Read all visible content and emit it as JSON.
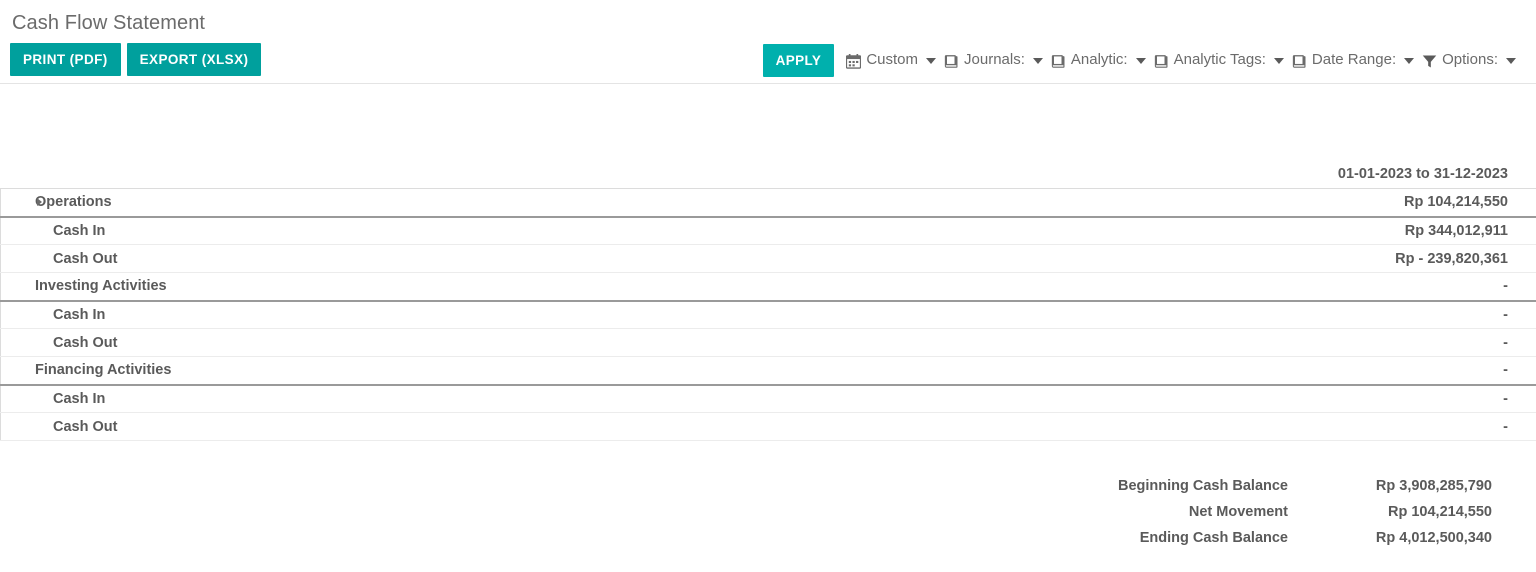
{
  "page": {
    "title": "Cash Flow Statement"
  },
  "toolbar": {
    "print_label": "PRINT (PDF)",
    "export_label": "EXPORT (XLSX)",
    "apply_label": "APPLY",
    "filters": [
      {
        "icon": "calendar-icon",
        "label": "Custom"
      },
      {
        "icon": "book-icon",
        "label": "Journals:"
      },
      {
        "icon": "book-icon",
        "label": "Analytic:"
      },
      {
        "icon": "book-icon",
        "label": "Analytic Tags:"
      },
      {
        "icon": "book-icon",
        "label": "Date Range:"
      },
      {
        "icon": "filter-icon",
        "label": "Options:"
      }
    ]
  },
  "report": {
    "column_header": "01-01-2023 to 31-12-2023",
    "rows": [
      {
        "label": "Operations",
        "value": "Rp  104,214,550",
        "level": 0,
        "expandable": true
      },
      {
        "label": "Cash In",
        "value": "Rp  344,012,911",
        "level": 1,
        "expandable": false
      },
      {
        "label": "Cash Out",
        "value": "Rp - 239,820,361",
        "level": 1,
        "expandable": false
      },
      {
        "label": "Investing Activities",
        "value": "-",
        "level": 0,
        "expandable": false
      },
      {
        "label": "Cash In",
        "value": "-",
        "level": 1,
        "expandable": false
      },
      {
        "label": "Cash Out",
        "value": "-",
        "level": 1,
        "expandable": false
      },
      {
        "label": "Financing Activities",
        "value": "-",
        "level": 0,
        "expandable": false
      },
      {
        "label": "Cash In",
        "value": "-",
        "level": 1,
        "expandable": false
      },
      {
        "label": "Cash Out",
        "value": "-",
        "level": 1,
        "expandable": false
      }
    ],
    "summary": [
      {
        "label": "Beginning Cash Balance",
        "value": "Rp  3,908,285,790"
      },
      {
        "label": "Net Movement",
        "value": "Rp  104,214,550"
      },
      {
        "label": "Ending Cash Balance",
        "value": "Rp  4,012,500,340"
      }
    ]
  },
  "colors": {
    "accent": "#00a09d",
    "accent_apply": "#00b0ad",
    "text": "#5a5a5a",
    "title": "#6b6b6b",
    "rule_strong": "#9a9a9a",
    "rule_light": "#ececec"
  }
}
